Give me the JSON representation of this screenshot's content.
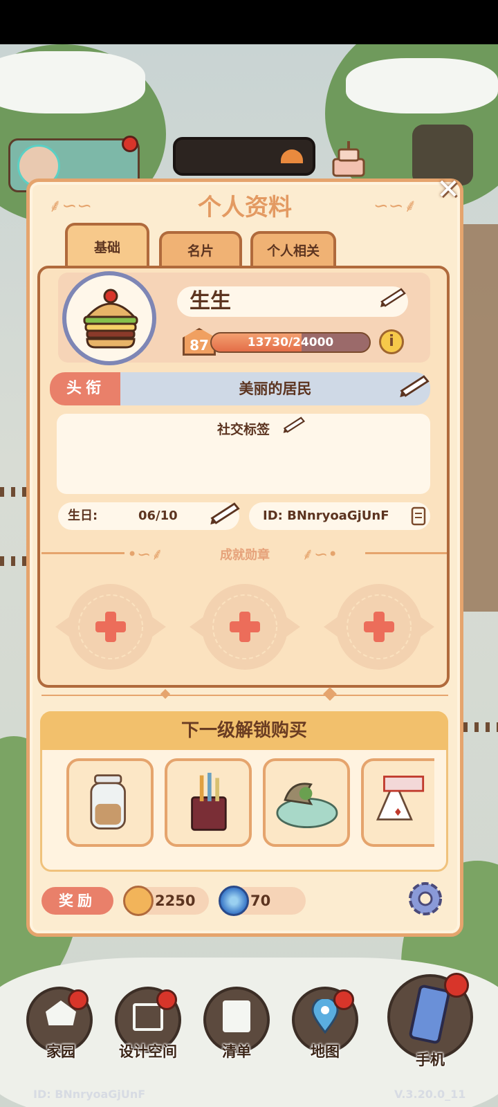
{
  "dialog": {
    "title": "个人资料",
    "close_label": "✕"
  },
  "tabs": [
    {
      "label": "基础",
      "active": true
    },
    {
      "label": "名片",
      "active": false
    },
    {
      "label": "个人相关",
      "active": false
    }
  ],
  "profile": {
    "avatar_icon": "burger-icon",
    "name": "生生",
    "level": "87",
    "xp_text": "13730/24000",
    "xp_progress": 0.572,
    "info_label": "i"
  },
  "title_row": {
    "label": "头衔",
    "value": "美丽的居民"
  },
  "social_tags": {
    "label": "社交标签"
  },
  "birthday": {
    "label": "生日:",
    "value": "06/10"
  },
  "user_id": {
    "text": "ID: BNnryoaGjUnF"
  },
  "achievements": {
    "title": "成就勋章",
    "slots": [
      "add",
      "add",
      "add"
    ]
  },
  "unlock_shop": {
    "title": "下一级解锁购买",
    "items": [
      "glass-jar-icon",
      "pen-holder-icon",
      "bonsai-tray-icon",
      "card-house-icon"
    ]
  },
  "rewards": {
    "label": "奖励",
    "coins": "2250",
    "gems": "70"
  },
  "bottom_nav": [
    {
      "label": "家园",
      "icon": "home-icon"
    },
    {
      "label": "设计空间",
      "icon": "design-icon"
    },
    {
      "label": "清单",
      "icon": "list-icon"
    },
    {
      "label": "地图",
      "icon": "map-pin-icon"
    },
    {
      "label": "手机",
      "icon": "phone-icon"
    }
  ],
  "footer": {
    "id_text": "ID: BNnryoaGjUnF",
    "version": "V.3.20.0_11"
  },
  "colors": {
    "panel_bg": "#fcecd0",
    "accent_orange": "#e5a46d",
    "label_red": "#e9806a",
    "title_blue": "#cfd9e6"
  }
}
